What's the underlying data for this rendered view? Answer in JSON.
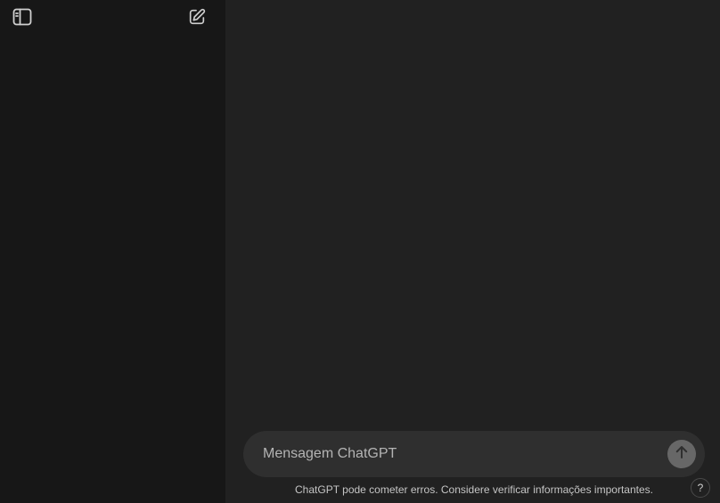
{
  "sidebar": {
    "toggle_icon": "sidebar-toggle-icon",
    "new_chat_icon": "edit-pencil-icon"
  },
  "composer": {
    "placeholder": "Mensagem ChatGPT",
    "value": "",
    "send_icon": "arrow-up-icon"
  },
  "footer": {
    "disclaimer": "ChatGPT pode cometer erros. Considere verificar informações importantes.",
    "help_label": "?"
  },
  "colors": {
    "sidebar_bg": "#171717",
    "main_bg": "#212121",
    "composer_bg": "#2f2f2f",
    "send_button_bg": "#676767"
  }
}
